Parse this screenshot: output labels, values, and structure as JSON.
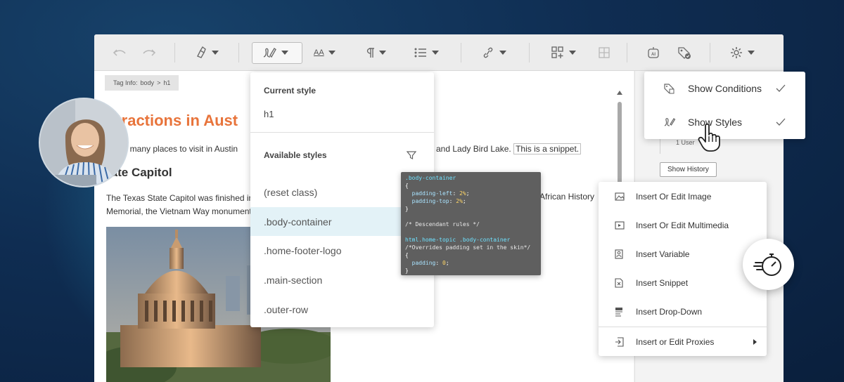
{
  "toolbar": {
    "icons": [
      "undo-icon",
      "redo-icon",
      "highlighter-icon",
      "style-brush-icon",
      "font-size-icon",
      "paragraph-icon",
      "list-icon",
      "link-icon",
      "insert-grid-icon",
      "table-icon",
      "ai-icon",
      "conditions-tag-icon",
      "settings-gear-icon"
    ],
    "font_size_label": "AA"
  },
  "tag_info": {
    "label": "Tag Info:",
    "path_body": "body",
    "separator": ">",
    "path_h1": "h1"
  },
  "document": {
    "heading": "ttractions in Aust",
    "para1_left": "are many places to visit in Austin",
    "para1_right": "and Lady Bird Lake.",
    "snippet": "This is a snippet.",
    "heading2": "tate Capitol",
    "para2_line1": "The Texas State Capitol was finished in",
    "para2_line2": "Memorial, the Vietnam Way monument,",
    "para2_right": "African History"
  },
  "style_dropdown": {
    "current_label": "Current style",
    "current_value": "h1",
    "available_label": "Available styles",
    "items": [
      {
        "label": "(reset class)",
        "highlighted": false
      },
      {
        "label": ".body-container",
        "highlighted": true
      },
      {
        "label": ".home-footer-logo",
        "highlighted": false
      },
      {
        "label": ".main-section",
        "highlighted": false
      },
      {
        "label": ".outer-row",
        "highlighted": false
      }
    ]
  },
  "code_popup": {
    "sel1": ".body-container",
    "brace_open": "{",
    "prop1": "padding-left",
    "val1": "2%",
    "prop2": "padding-top",
    "val2": "2%",
    "brace_close": "}",
    "comment1": "/* Descendant rules */",
    "sel2": "html.home-topic .body-container",
    "comment2": "/*Overrides padding set in the skin*/",
    "prop3": "padding",
    "val3": "0"
  },
  "view_menu": {
    "items": [
      {
        "label": "Show Conditions",
        "icon": "conditions-icon",
        "checked": true
      },
      {
        "label": "Show Styles",
        "icon": "styles-icon",
        "checked": true
      }
    ]
  },
  "right_panel": {
    "users_text": "1 User",
    "show_history_label": "Show History"
  },
  "insert_menu": {
    "items": [
      {
        "label": "Insert Or Edit Image",
        "icon": "image-icon"
      },
      {
        "label": "Insert Or Edit Multimedia",
        "icon": "multimedia-icon"
      },
      {
        "label": "Insert Variable",
        "icon": "variable-icon"
      },
      {
        "label": "Insert Snippet",
        "icon": "snippet-icon"
      },
      {
        "label": "Insert Drop-Down",
        "icon": "dropdown-icon"
      },
      {
        "label": "Insert or Edit Proxies",
        "icon": "proxy-icon",
        "has_submenu": true
      }
    ]
  },
  "colors": {
    "heading_orange": "#e8743b",
    "highlight_row": "#e3f2f7",
    "background_navy": "#0f2d52"
  }
}
